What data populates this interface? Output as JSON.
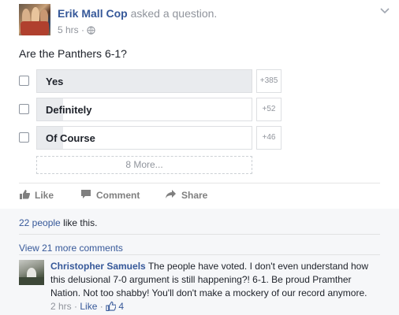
{
  "post": {
    "author": "Erik Mall Cop",
    "action_text": "asked a question.",
    "time": "5 hrs",
    "dot": "·",
    "privacy_icon": "globe-icon",
    "menu_icon": "chevron-down-icon",
    "question": "Are the Panthers 6-1?"
  },
  "poll": {
    "options": [
      {
        "label": "Yes",
        "count": "+385",
        "share": 1.0
      },
      {
        "label": "Definitely",
        "count": "+52",
        "share": 0.12
      },
      {
        "label": "Of Course",
        "count": "+46",
        "share": 0.12
      }
    ],
    "more_label": "8 More..."
  },
  "actions": {
    "like": "Like",
    "comment": "Comment",
    "share": "Share"
  },
  "likes": {
    "people": "22 people",
    "suffix": "like this."
  },
  "comments": {
    "view_more": "View 21 more comments",
    "items": [
      {
        "author": "Christopher Samuels",
        "text": "The people have voted. I don't even understand how this delusional 7-0 argument is still happening?! 6-1. Be proud Pramther Nation. Not too shabby! You'll don't make a mockery of our record anymore.",
        "time": "2 hrs",
        "dot": "·",
        "like_label": "Like",
        "like_count": "4"
      }
    ]
  },
  "colors": {
    "link": "#365899",
    "muted": "#90949c",
    "bar_fill": "#e9ebee",
    "border": "#dddfe2"
  }
}
